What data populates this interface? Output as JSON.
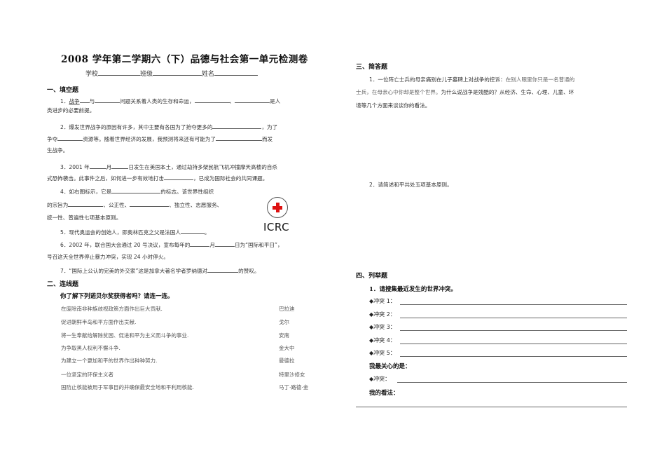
{
  "left": {
    "title": "2008 学年第二学期六（下）品德与社会第一单元检测卷",
    "header": {
      "school": "学校",
      "class": "班级",
      "name": "姓名"
    },
    "sec1": "一、填空题",
    "q1": {
      "a": "1．",
      "b": "战争",
      "c": "与",
      "d": "问题关系着人类的生存和命运，",
      "e": "、",
      "f": "是人",
      "g": "类进步的必要前提。"
    },
    "q2": {
      "a": "2．爆发世界战争的原因有许多，其中主要有各国为了抢夺更多的",
      "b": "，为了",
      "c": "争夺",
      "d": "资源等。随着世界经济的发展，我预测将来还有可能为了",
      "e": "而发",
      "f": "生战争。"
    },
    "q3": {
      "a": "3．2001 年",
      "b": "月",
      "c": "日发生在美国本土，通过劫持多架民航飞机冲撞摩天高楼的自杀",
      "d": "式恐怖袭击。此事件之后，如何进一步有效地打击",
      "e": "，已成为国际社会的共同课题。"
    },
    "q4": {
      "a": "4．如右图标示，它是",
      "b": "的标志。该世界性组织",
      "c": "的宗旨为",
      "d": "、公正性、",
      "e": "、独立性、志愿服务、",
      "f": "统一性、普遍性七项基本原则。"
    },
    "q5": {
      "a": "5．现代奥运会的创始人，即奥林匹克之父是法国人",
      "b": "。"
    },
    "q6": {
      "a": "6．2002 年，联合国大会通过 20 号决议，宣布每年的",
      "b": "月",
      "c": "日为“国际和平日”，",
      "d": "号召这天全世界停止暴力冲突，实现 24 小时停火。"
    },
    "q7": {
      "a": "7．“国际上公认的完美的外交家”这是加拿大著名学者罗纳德对",
      "b": "的赞叹。"
    },
    "logo": {
      "ring_text": "COMITE INTERNATIONAL GENEVE",
      "caption": "ICRC"
    },
    "sec2": "二、连线题",
    "q8": "你了解下列诺贝尔奖获得者吗？请连一连。",
    "match": [
      {
        "left": "在废除南非种族歧视政策方面作出巨大贡献.",
        "right": "巴拉迪"
      },
      {
        "left": "促进朝鲜半岛和平方面作出贡献.",
        "right": "戈尔"
      },
      {
        "left": "将一生奉献给解除贫困、促进和平为主义而斗争的事业.",
        "right": "安南"
      },
      {
        "left": "为争取黑人权利不懈斗争.",
        "right": "金大中"
      },
      {
        "left": "为建立一个更加和平的世界作出种种努力.",
        "right": "曼德拉"
      },
      {
        "left": "一位坚定的环保主义者",
        "right": "特里沙修女"
      },
      {
        "left": "国防止核能被用于军事目的并确保最安全地和平利用核能.",
        "right": "马丁·路德·金"
      }
    ]
  },
  "right": {
    "sec3": "三、简答题",
    "q1": {
      "a": "1．一位阵亡士兵的母亲痛别在儿子墓碑上对战争的控诉：",
      "b": "在别人眼里你只是一名普通的",
      "c": "士兵，在母亲心中你却是整个世界。",
      "d": "为什么说战争是残酷的？从经济、生命、心理、儿童、环",
      "e": "境等几个方面来谈谈你的看法。"
    },
    "q2": "2．请简述和平共处五项基本原则。",
    "sec4": "四、列举题",
    "sub1": "1．请搜集最近发生的世界冲突。",
    "conflicts": [
      "◆冲突 1：",
      "◆冲突 2：",
      "◆冲突 3：",
      "◆冲突 4：",
      "◆冲突 5："
    ],
    "care_label": "我最关心的是：",
    "care_item": "◆冲突：",
    "view_label": "我的看法："
  }
}
